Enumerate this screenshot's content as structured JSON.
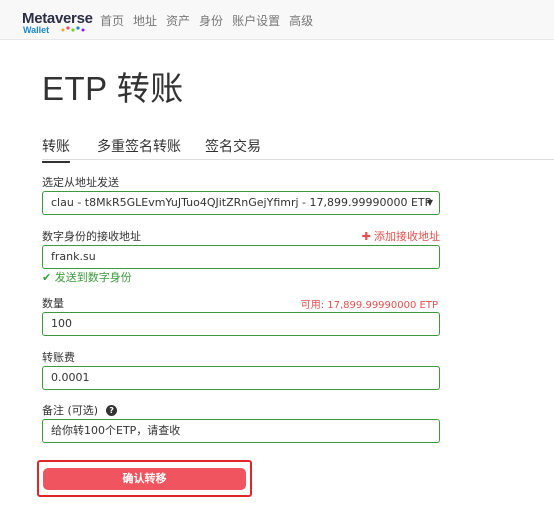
{
  "brand": {
    "name": "Metaverse",
    "sub": "Wallet"
  },
  "nav": {
    "items": [
      "首页",
      "地址",
      "资产",
      "身份",
      "账户设置",
      "高级"
    ]
  },
  "page": {
    "title": "ETP 转账"
  },
  "tabs": [
    {
      "label": "转账",
      "active": true
    },
    {
      "label": "多重签名转账",
      "active": false
    },
    {
      "label": "签名交易",
      "active": false
    }
  ],
  "form": {
    "from": {
      "label": "选定从地址发送",
      "value": "clau - t8MkR5GLEvmYuJTuo4QJitZRnGejYfimrj - 17,899.99990000 ETP"
    },
    "recipient": {
      "label": "数字身份的接收地址",
      "add_link": "添加接收地址",
      "value": "frank.su",
      "status": "发送到数字身份"
    },
    "amount": {
      "label": "数量",
      "available": "可用: 17,899.99990000 ETP",
      "value": "100"
    },
    "fee": {
      "label": "转账费",
      "value": "0.0001"
    },
    "memo": {
      "label": "备注 (可选)",
      "value": "给你转100个ETP，请查收"
    }
  },
  "confirm": {
    "label": "确认转移"
  },
  "colors": {
    "accent_red": "#f0545e",
    "success_green": "#3c9a3c",
    "highlight_border": "#e0252b",
    "brand_blue": "#1e88c9"
  }
}
